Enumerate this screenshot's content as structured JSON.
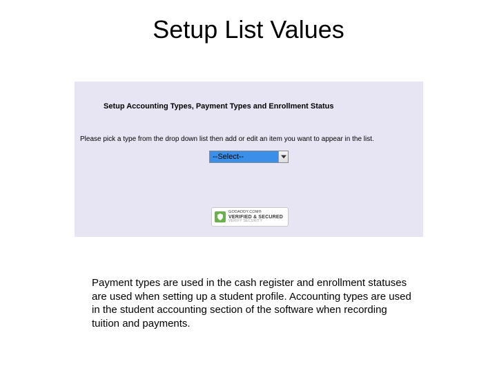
{
  "title": "Setup List Values",
  "panel": {
    "heading": "Setup Accounting Types, Payment Types and Enrollment Status",
    "instruction": "Please pick a type from the drop down list then add or edit an item you want to appear in the list.",
    "select": {
      "value": "--Select--"
    },
    "badge": {
      "line1": "GODADDY.COM®",
      "line2": "VERIFIED & SECURED",
      "line3": "VERIFY SECURITY"
    }
  },
  "caption": "Payment types are used in the cash register and enrollment statuses are used when setting up a student profile. Accounting types are used in the student accounting section of the software when recording tuition and payments."
}
